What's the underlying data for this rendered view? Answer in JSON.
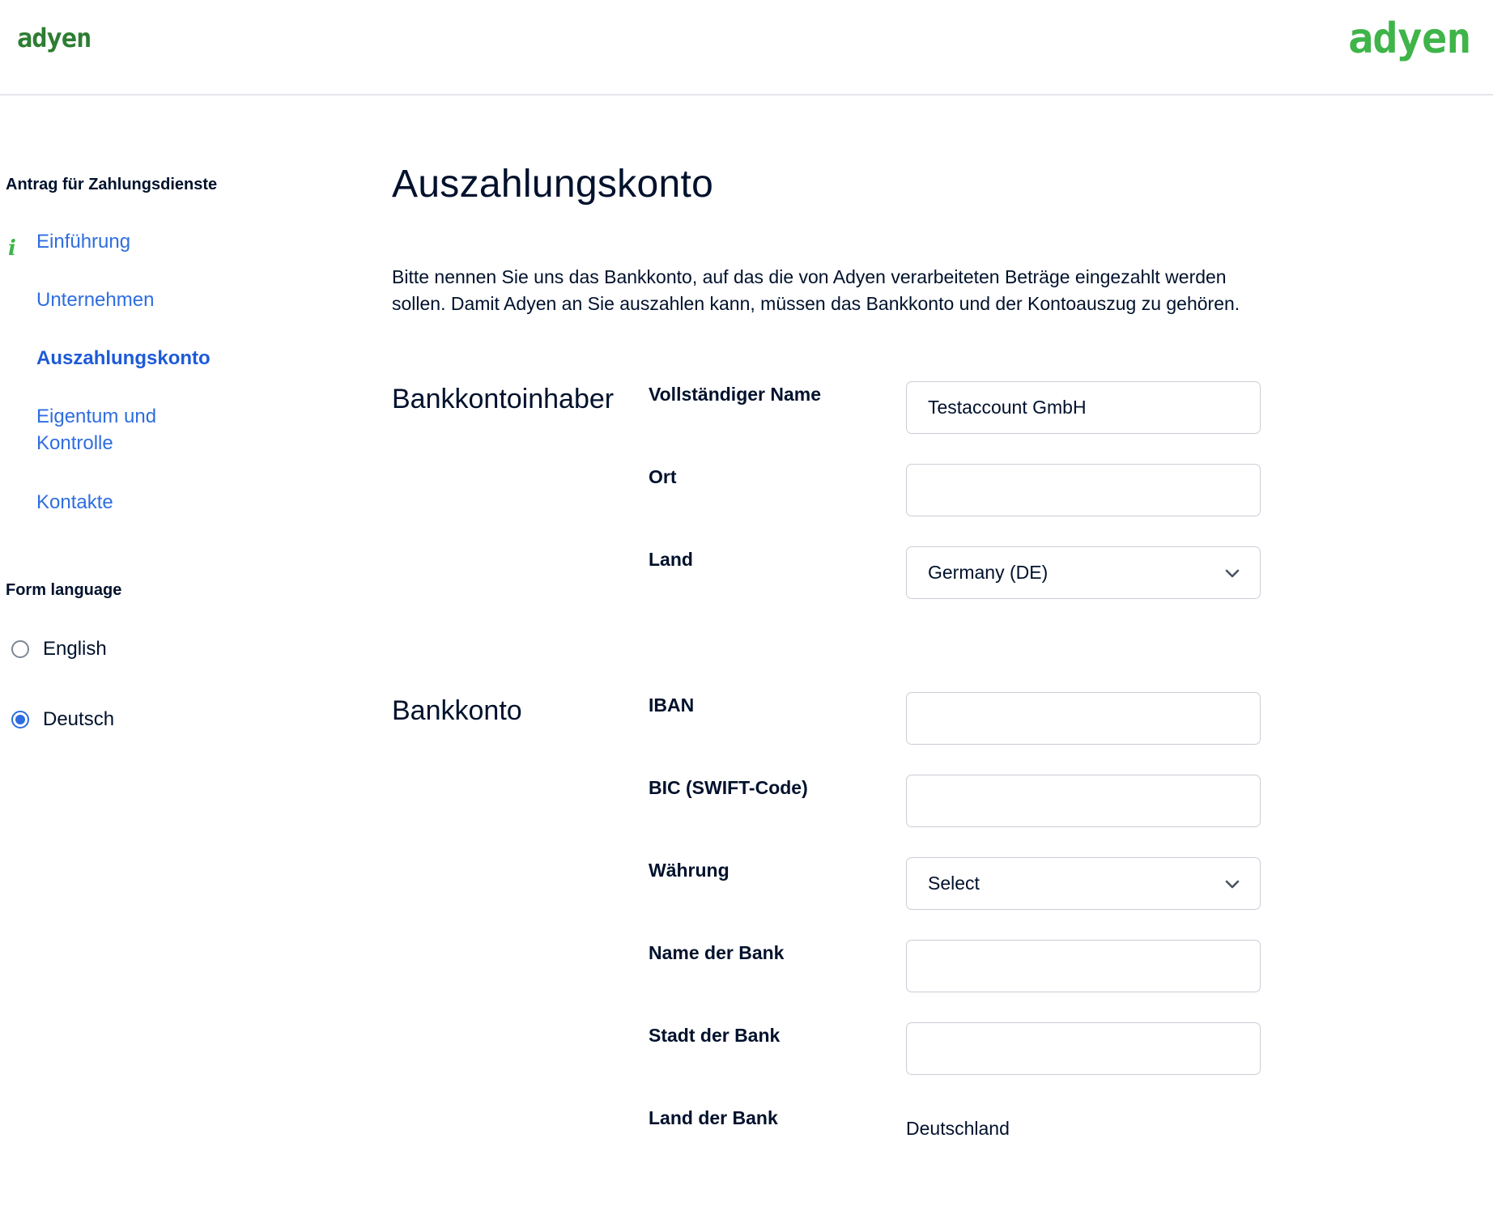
{
  "header": {
    "logo_small": "adyen",
    "logo_large": "adyen"
  },
  "sidebar": {
    "heading": "Antrag für Zahlungsdienste",
    "nav": [
      {
        "label": "Einführung"
      },
      {
        "label": "Unternehmen"
      },
      {
        "label": "Auszahlungskonto",
        "active": true
      },
      {
        "label_line1": "Eigentum und",
        "label_line2": "Kontrolle"
      },
      {
        "label": "Kontakte"
      }
    ],
    "language_heading": "Form language",
    "languages": [
      {
        "label": "English",
        "checked": false
      },
      {
        "label": "Deutsch",
        "checked": true
      }
    ]
  },
  "main": {
    "title": "Auszahlungskonto",
    "intro_line1": "Bitte nennen Sie uns das Bankkonto, auf das die von Adyen verarbeiteten Beträge eingezahlt werden",
    "intro_line2": "sollen. Damit Adyen an Sie auszahlen kann, müssen das Bankkonto und der Kontoauszug zu gehören.",
    "sections": {
      "holder": {
        "title": "Bankkontoinhaber",
        "full_name_label": "Vollständiger Name",
        "full_name_value": "Testaccount GmbH",
        "city_label": "Ort",
        "city_value": "",
        "country_label": "Land",
        "country_value": "Germany (DE)"
      },
      "account": {
        "title": "Bankkonto",
        "iban_label": "IBAN",
        "iban_value": "",
        "bic_label": "BIC (SWIFT-Code)",
        "bic_value": "",
        "currency_label": "Währung",
        "currency_value": "Select",
        "bank_name_label": "Name der Bank",
        "bank_name_value": "",
        "bank_city_label": "Stadt der Bank",
        "bank_city_value": "",
        "bank_country_label": "Land der Bank",
        "bank_country_value": "Deutschland"
      }
    }
  },
  "colors": {
    "brand_green": "#3fb449",
    "link_blue": "#2e6de0",
    "text": "#00112c",
    "border": "#c9ced6"
  }
}
